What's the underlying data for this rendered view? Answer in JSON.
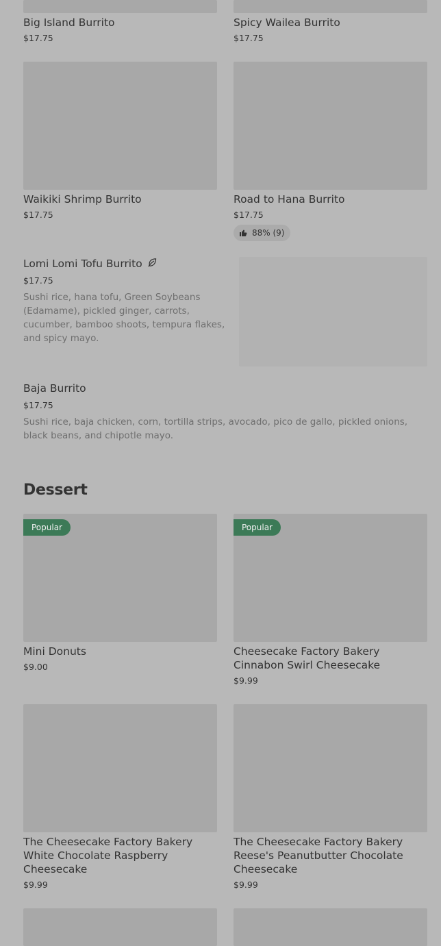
{
  "colors": {
    "page_background": "#b8b8b8",
    "image_placeholder": "#a8a8a8",
    "popular_badge": "#3c7a57",
    "text_primary": "#333333",
    "text_secondary": "#6e6e6e"
  },
  "burritos": {
    "big_island": {
      "name": "Big Island Burrito",
      "price": "$17.75"
    },
    "spicy_wailea": {
      "name": "Spicy Wailea Burrito",
      "price": "$17.75"
    },
    "waikiki_shrimp": {
      "name": "Waikiki Shrimp Burrito",
      "price": "$17.75"
    },
    "road_to_hana": {
      "name": "Road to Hana Burrito",
      "price": "$17.75",
      "rating": "88% (9)",
      "rating_icon": "thumbs-up-icon"
    },
    "lomi_lomi_tofu": {
      "name": "Lomi Lomi Tofu Burrito",
      "icon": "leaf-icon",
      "price": "$17.75",
      "description": "Sushi rice, hana tofu, Green Soybeans (Edamame), pickled ginger, carrots, cucumber, bamboo shoots, tempura flakes, and spicy mayo."
    },
    "baja": {
      "name": "Baja Burrito",
      "price": "$17.75",
      "description": "Sushi rice, baja chicken, corn, tortilla strips, avocado, pico de gallo, pickled onions, black beans, and chipotle mayo."
    }
  },
  "dessert": {
    "section_title": "Dessert",
    "items": [
      {
        "name": "Mini Donuts",
        "price": "$9.00",
        "badge": "Popular"
      },
      {
        "name": "Cheesecake Factory Bakery Cinnabon Swirl Cheesecake",
        "price": "$9.99",
        "badge": "Popular"
      },
      {
        "name": "The Cheesecake Factory Bakery White Chocolate Raspberry Cheesecake",
        "price": "$9.99"
      },
      {
        "name": "The Cheesecake Factory Bakery Reese's Peanutbutter Chocolate Cheesecake",
        "price": "$9.99"
      }
    ]
  }
}
